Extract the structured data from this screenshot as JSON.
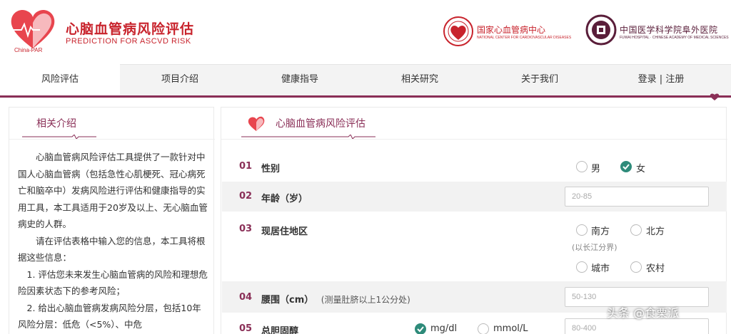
{
  "header": {
    "logo_sub": "China-PAR",
    "title_cn": "心脑血管病风险评估",
    "title_en": "PREDICTION FOR ASCVD RISK",
    "partner1_name": "国家心血管病中心",
    "partner1_sub": "NATIONAL CENTER FOR CARDIOVASCULAR DISEASES",
    "partner2_name": "中国医学科学院阜外医院",
    "partner2_sub": "FUWAI HOSPITAL · CHINESE ACADEMY OF MEDICAL SCIENCES"
  },
  "nav": {
    "items": [
      "风险评估",
      "项目介绍",
      "健康指导",
      "相关研究",
      "关于我们",
      "登录 | 注册"
    ],
    "active_index": 0
  },
  "left": {
    "title": "相关介绍",
    "paragraphs": [
      "心脑血管病风险评估工具提供了一款针对中国人心脑血管病（包括急性心肌梗死、冠心病死亡和脑卒中）发病风险进行评估和健康指导的实用工具，本工具适用于20岁及以上、无心脑血管病史的人群。",
      "请在评估表格中输入您的信息，本工具将根据这些信息：",
      "1. 评估您未来发生心脑血管病的风险和理想危险因素状态下的参考风险；",
      "2. 给出心脑血管病发病风险分层，包括10年风险分层：低危（<5%）、中危"
    ]
  },
  "form": {
    "title": "心脑血管病风险评估",
    "rows": {
      "sex": {
        "num": "01",
        "label": "性别",
        "options": [
          "男",
          "女"
        ],
        "selected": "女"
      },
      "age": {
        "num": "02",
        "label": "年龄（岁）",
        "placeholder": "20-85"
      },
      "region": {
        "num": "03",
        "label": "现居住地区",
        "options_a": [
          "南方",
          "北方"
        ],
        "hint": "(以长江分界)",
        "options_b": [
          "城市",
          "农村"
        ]
      },
      "waist": {
        "num": "04",
        "label": "腰围（cm）",
        "note": "(测量肚脐以上1公分处)",
        "placeholder": "50-130"
      },
      "chol": {
        "num": "05",
        "label": "总胆固醇",
        "units": [
          "mg/dl",
          "mmol/L"
        ],
        "selected_unit": "mg/dl",
        "placeholder": "80-400"
      }
    }
  },
  "watermark": "头条 @食栗派",
  "colors": {
    "brand_red": "#c8232c",
    "brand_plum": "#8a2f57",
    "check_green": "#2e8b7a"
  }
}
